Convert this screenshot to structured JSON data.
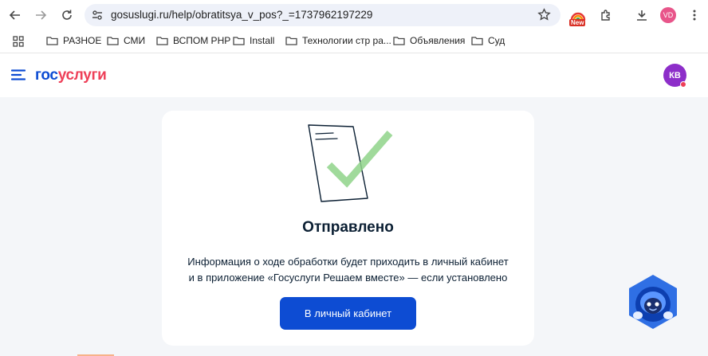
{
  "browser": {
    "url": "gosuslugi.ru/help/obratitsya_v_pos?_=1737962197229",
    "extension_badge": "New",
    "profile_initials": "VD"
  },
  "bookmarks": [
    {
      "label": "РАЗНОЕ"
    },
    {
      "label": "СМИ"
    },
    {
      "label": "ВСПОМ PHP"
    },
    {
      "label": "Install"
    },
    {
      "label": "Технологии стр ра..."
    },
    {
      "label": "Объявления"
    },
    {
      "label": "Суд"
    }
  ],
  "site": {
    "logo_part1": "гос",
    "logo_part2": "услуги",
    "avatar_initials": "КВ"
  },
  "card": {
    "title": "Отправлено",
    "desc_line1": "Информация о ходе обработки будет приходить в личный кабинет",
    "desc_line2": "и в приложение «Госуслуги Решаем вместе» — если установлено",
    "button_label": "В личный кабинет"
  },
  "colors": {
    "brand_blue": "#0d4cd3",
    "brand_red": "#ee3f58",
    "avatar_purple": "#8d2ec9",
    "page_bg": "#f4f6f9"
  }
}
